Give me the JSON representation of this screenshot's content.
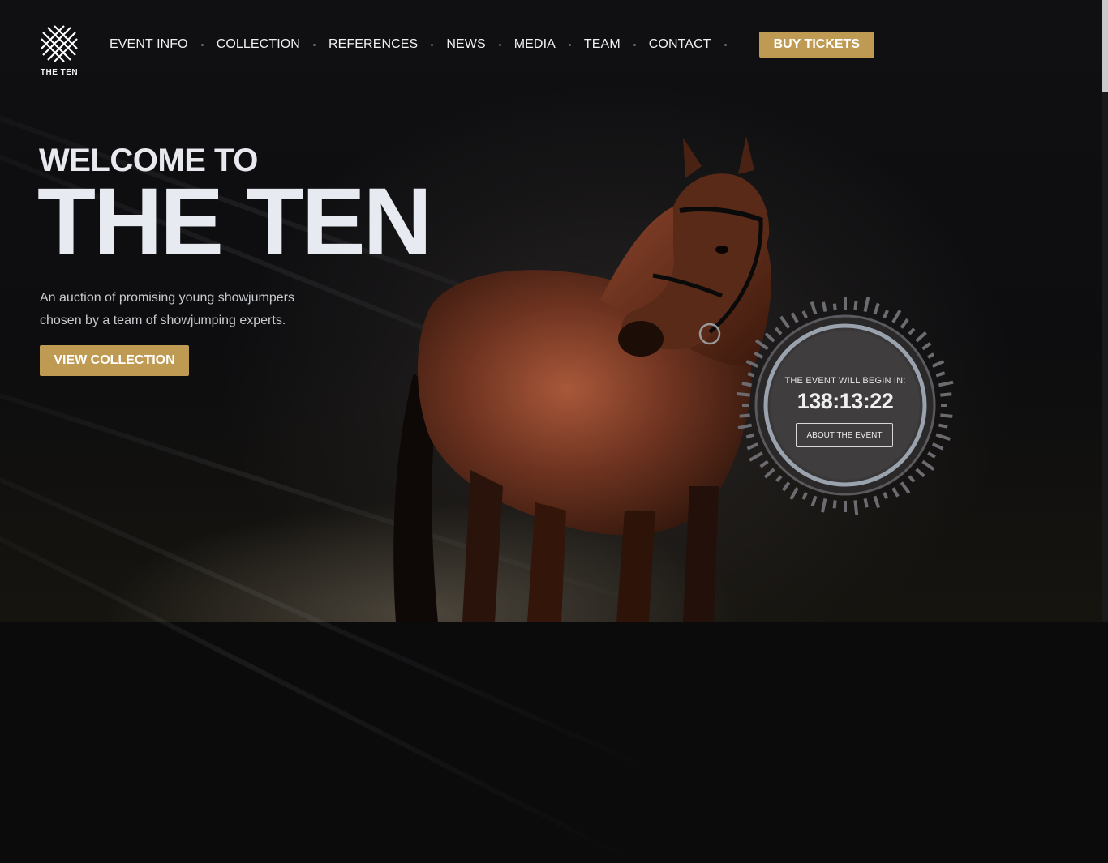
{
  "brand": {
    "name": "THE TEN",
    "logo_icon": "crossed-lines-logo-icon"
  },
  "nav": {
    "items": [
      {
        "label": "EVENT INFO"
      },
      {
        "label": "COLLECTION"
      },
      {
        "label": "REFERENCES"
      },
      {
        "label": "NEWS"
      },
      {
        "label": "MEDIA"
      },
      {
        "label": "TEAM"
      },
      {
        "label": "CONTACT"
      }
    ],
    "buy_tickets": "BUY TICKETS"
  },
  "hero": {
    "welcome": "WELCOME TO",
    "title": "THE TEN",
    "subtitle": "An auction of promising young showjumpers chosen by a team of showjumping experts.",
    "cta": "VIEW COLLECTION"
  },
  "countdown": {
    "label": "THE EVENT WILL BEGIN IN:",
    "time": "138:13:22",
    "button": "ABOUT THE EVENT"
  },
  "colors": {
    "accent": "#bf9a53",
    "background": "#0b0b0c",
    "text": "#e7eaf0"
  }
}
